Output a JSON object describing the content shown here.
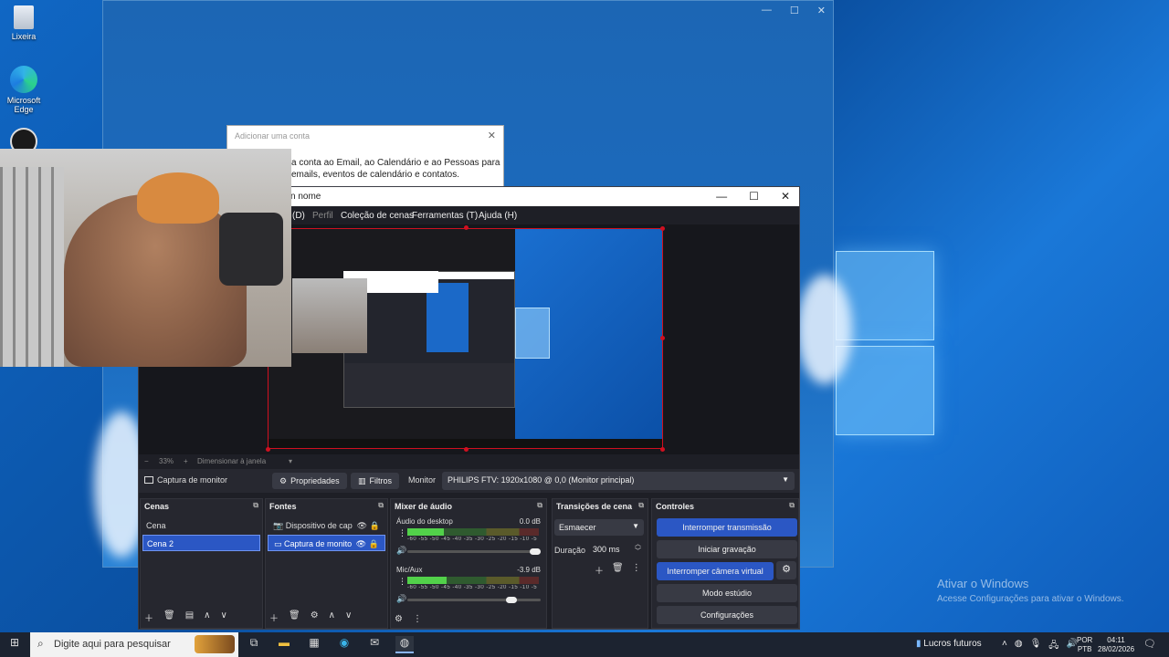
{
  "desktop": {
    "icons": [
      {
        "label": "Lixeira"
      },
      {
        "label": "Microsoft Edge"
      }
    ],
    "activate_windows": {
      "title": "Ativar o Windows",
      "subtitle": "Acesse Configurações para ativar o Windows."
    }
  },
  "dialog": {
    "title": "Adicionar uma conta",
    "close": "✕",
    "line1": "a conta ao Email, ao Calendário e ao Pessoas para",
    "line2": "emails, eventos de calendário e contatos."
  },
  "obs": {
    "title": "n nome",
    "menu": {
      "m1": "(D)",
      "m2": "Perfil",
      "m3": "Coleção de cenas",
      "m4": "Ferramentas (T)",
      "m5": "Ajuda (H)"
    },
    "zoom": {
      "minus": "−",
      "value": "33%",
      "plus": "+",
      "mode": "Dimensionar à janela",
      "caret": "▾"
    },
    "source_toolbar": {
      "source_name": "Captura de monitor",
      "properties": "Propriedades",
      "filters": "Filtros",
      "monitor_label": "Monitor",
      "monitor_value": "PHILIPS FTV: 1920x1080 @ 0,0 (Monitor principal)"
    },
    "scenes": {
      "title": "Cenas",
      "items": [
        {
          "label": "Cena"
        },
        {
          "label": "Cena 2"
        }
      ]
    },
    "sources": {
      "title": "Fontes",
      "items": [
        {
          "label": "Dispositivo de cap"
        },
        {
          "label": "Captura de monito"
        }
      ]
    },
    "mixer": {
      "title": "Mixer de áudio",
      "channels": [
        {
          "name": "Áudio do desktop",
          "db": "0.0 dB",
          "level": 0.28,
          "volume": 1.0
        },
        {
          "name": "Mic/Aux",
          "db": "-3.9 dB",
          "level": 0.3,
          "volume": 0.82
        }
      ],
      "scale": "-60 -55 -50 -45 -40 -35 -30 -25 -20 -15 -10 -5 0"
    },
    "transitions": {
      "title": "Transições de cena",
      "selected": "Esmaecer",
      "duration_label": "Duração",
      "duration_value": "300 ms"
    },
    "controls": {
      "title": "Controles",
      "buttons": {
        "stop_stream": "Interromper transmissão",
        "start_record": "Iniciar gravação",
        "stop_vcam": "Interromper câmera virtual",
        "studio_mode": "Modo estúdio",
        "settings": "Configurações"
      }
    }
  },
  "taskbar": {
    "search_placeholder": "Digite aqui para pesquisar",
    "news": "Lucros futuros",
    "lang_top": "POR",
    "lang_bottom": "PTB",
    "time": "04:11",
    "date": "28/02/2026"
  },
  "colors": {
    "accent": "#2b57c4",
    "selection_border": "#d01020",
    "meter_green": "#52d14a"
  }
}
